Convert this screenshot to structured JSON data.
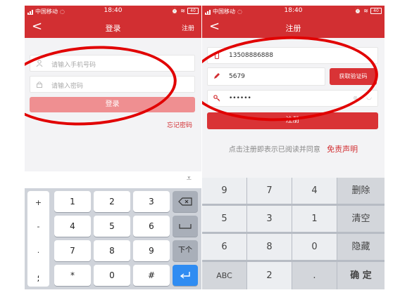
{
  "left_phone": {
    "status": {
      "carrier": "中国移动",
      "time": "18:40",
      "battery": "40"
    },
    "nav": {
      "back": "<",
      "title": "登录",
      "action": "注册"
    },
    "phone_placeholder": "请输入手机号码",
    "password_placeholder": "请输入密码",
    "login_button": "登录",
    "forgot_password": "忘记密码",
    "keyboard": {
      "symbols": [
        "+",
        "-",
        ".",
        ",",
        ";"
      ],
      "keys": [
        "1",
        "2",
        "3",
        "4",
        "5",
        "6",
        "7",
        "8",
        "9",
        "*",
        "0",
        "#"
      ],
      "next": "下个"
    }
  },
  "right_phone": {
    "status": {
      "carrier": "中国移动",
      "time": "18:40",
      "battery": "40"
    },
    "nav": {
      "back": "<",
      "title": "注册"
    },
    "phone_value": "13508886888",
    "code_value": "5679",
    "get_code_button": "获取验证码",
    "password_value": "••••••",
    "register_button": "注册",
    "agreement_text": "点击注册即表示已阅读并同意",
    "disclaimer_link": "免责声明",
    "keyboard": {
      "rows": [
        [
          "9",
          "7",
          "4",
          "删除"
        ],
        [
          "5",
          "3",
          "1",
          "清空"
        ],
        [
          "6",
          "8",
          "0",
          "隐藏"
        ],
        [
          "ABC",
          "2",
          ".",
          "确 定"
        ]
      ]
    }
  },
  "colors": {
    "brand_red": "#d22f32",
    "annotation_red": "#e10000",
    "enter_blue": "#2f8cf2"
  }
}
